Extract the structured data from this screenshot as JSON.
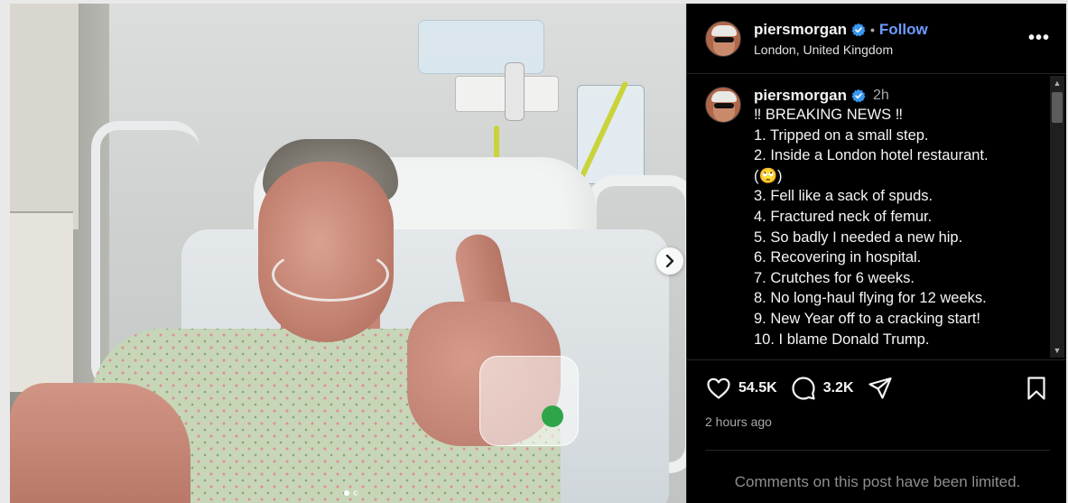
{
  "post": {
    "username": "piersmorgan",
    "follow_label": "Follow",
    "bullet": "•",
    "location": "London, United Kingdom",
    "more_label": "•••"
  },
  "caption": {
    "username": "piersmorgan",
    "time": "2h",
    "lines": [
      "‼ BREAKING NEWS ‼",
      "1. Tripped on a small step.",
      "2. Inside a London hotel restaurant.",
      "(🙄)",
      "3. Fell like a sack of spuds.",
      "4. Fractured neck of femur.",
      "5. So badly I needed a new hip.",
      "6. Recovering in hospital.",
      "7. Crutches for 6 weeks.",
      "8. No long-haul flying for 12 weeks.",
      "9. New Year off to a cracking start!",
      "10. I blame Donald Trump."
    ]
  },
  "actions": {
    "likes": "54.5K",
    "comments": "3.2K",
    "posted": "2 hours ago"
  },
  "comments_notice": "Comments on this post have been limited.",
  "icons": {
    "verified": "verified-badge-icon",
    "next": "chevron-right-icon",
    "like": "heart-icon",
    "comment": "comment-bubble-icon",
    "share": "paper-plane-icon",
    "save": "bookmark-icon"
  },
  "carousel": {
    "current": 1,
    "total": 2
  },
  "colors": {
    "accent": "#6e9bff",
    "verified": "#3897f0",
    "background": "#000000"
  }
}
